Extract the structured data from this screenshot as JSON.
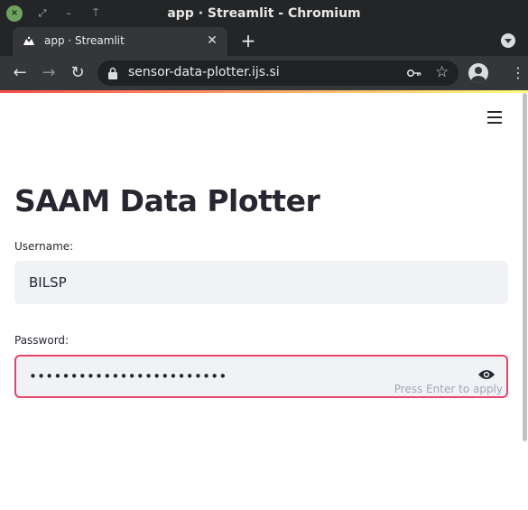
{
  "window": {
    "title": "app · Streamlit - Chromium"
  },
  "tab": {
    "title": "app · Streamlit"
  },
  "omnibox": {
    "url": "sensor-data-plotter.ijs.si"
  },
  "page": {
    "title": "SAAM Data Plotter"
  },
  "username": {
    "label": "Username:",
    "value": "BILSP"
  },
  "password": {
    "label": "Password:",
    "masked_value": "••••••••••••••••••••••••",
    "hint": "Press Enter to apply"
  },
  "colors": {
    "titlebar": "#232527",
    "toolbar": "#35363a",
    "omnibox": "#202124",
    "input_bg": "#f0f2f6",
    "focus_border": "#e8436a",
    "text": "#262730",
    "hint": "#a3a8b4"
  },
  "icons": [
    "window-close-icon",
    "window-minimize-icon",
    "window-restore-icon",
    "streamlit-favicon-icon",
    "tab-close-icon",
    "new-tab-icon",
    "tab-search-icon",
    "back-arrow-icon",
    "forward-arrow-icon",
    "reload-icon",
    "lock-icon",
    "key-icon",
    "star-icon",
    "profile-icon",
    "menu-kebab-icon",
    "hamburger-menu-icon",
    "eye-icon"
  ]
}
